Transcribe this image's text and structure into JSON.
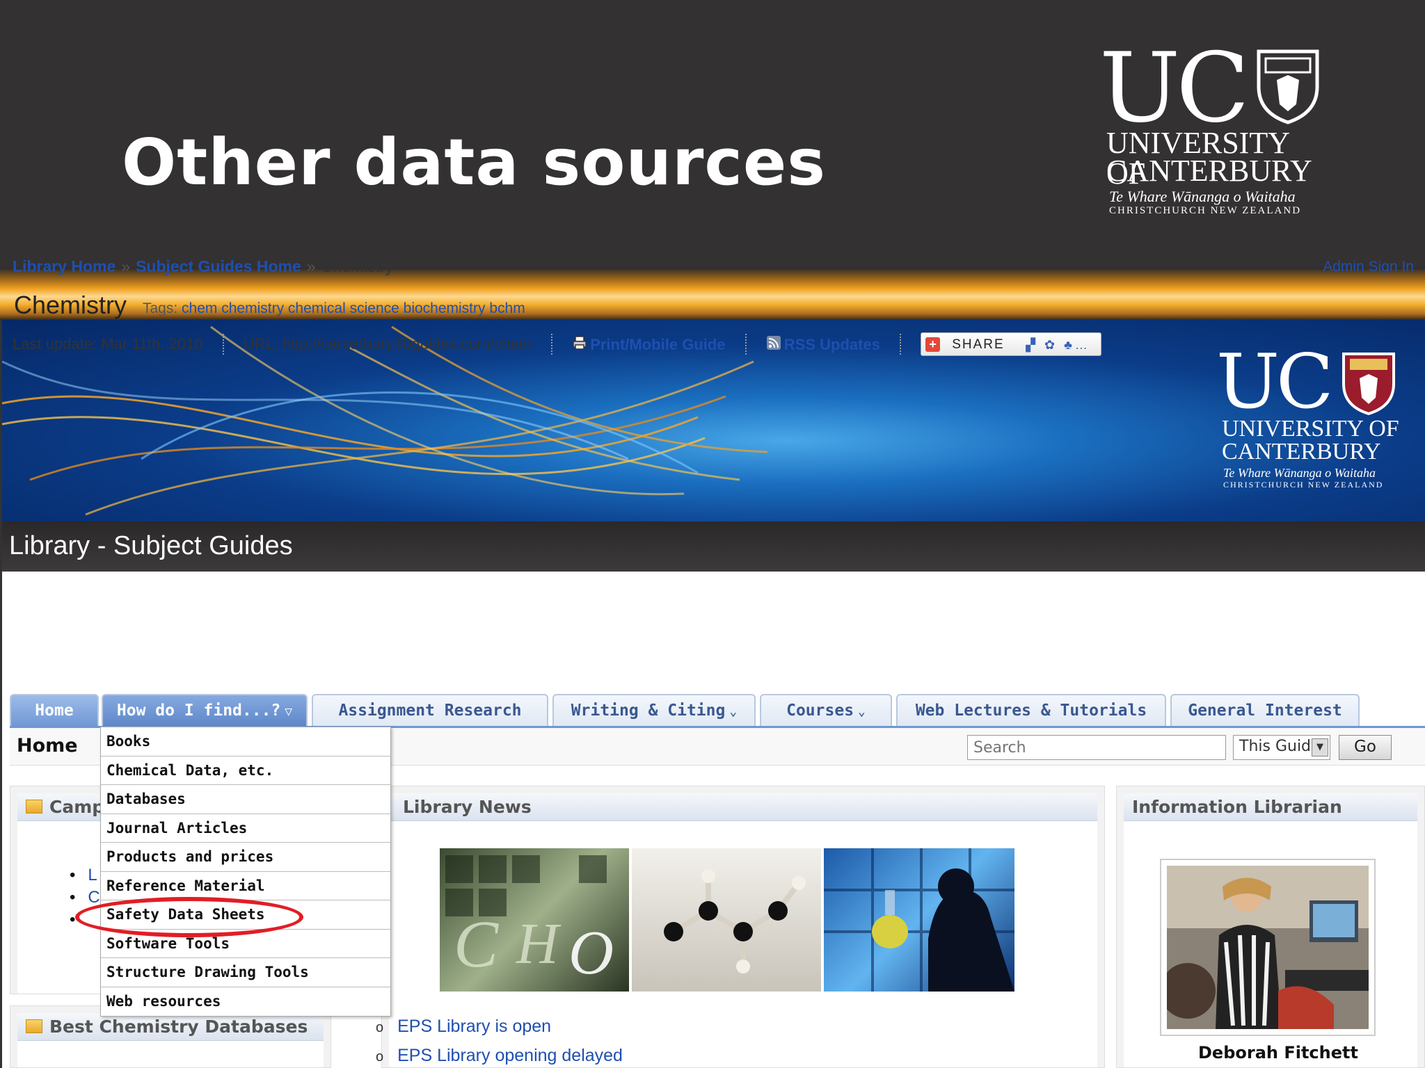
{
  "slide": {
    "title": "Other data sources",
    "logo": {
      "mark": "UC",
      "line1": "UNIVERSITY OF",
      "line2": "CANTERBURY",
      "line3": "Te Whare Wānanga o Waitaha",
      "line4": "CHRISTCHURCH NEW ZEALAND"
    }
  },
  "colors": {
    "slide_bg": "#333132",
    "link": "#1f4fb0",
    "tab_active": "#5d86c8",
    "highlight": "#e21d25"
  },
  "site": {
    "banner_logo": {
      "mark": "UC",
      "line1": "UNIVERSITY OF",
      "line2": "CANTERBURY",
      "line3": "Te Whare Wānanga o Waitaha",
      "line4": "CHRISTCHURCH NEW ZEALAND"
    },
    "section_title": "Library - Subject Guides",
    "breadcrumb": {
      "items": [
        "Library Home",
        "Subject Guides Home"
      ],
      "current": "Chemistry",
      "separator": "»"
    },
    "admin_link": "Admin Sign In",
    "guide": {
      "title": "Chemistry",
      "tags_label": "Tags:",
      "tags": "chem chemistry chemical science biochemistry bchm",
      "last_update": "Last update: Mar 11th, 2010",
      "url": "URL: http://canterbury.libguides.com/chem",
      "print_label": "Print/Mobile Guide",
      "rss_label": "RSS Updates",
      "share_label": "SHARE",
      "share_icons": "▞ ✿ ♣…"
    },
    "tabs": [
      {
        "label": "Home"
      },
      {
        "label": "How do I find...?",
        "chevron": "▽"
      },
      {
        "label": "Assignment Research"
      },
      {
        "label": "Writing & Citing",
        "chevron": "⌄"
      },
      {
        "label": "Courses",
        "chevron": "⌄"
      },
      {
        "label": "Web Lectures & Tutorials"
      },
      {
        "label": "General Interest"
      }
    ],
    "subbar": {
      "page_label": "Home",
      "search_placeholder": "Search",
      "scope": "This Guide",
      "go_label": "Go"
    },
    "dropdown_items": [
      "Books",
      "Chemical Data, etc.",
      "Databases",
      "Journal Articles",
      "Products and prices",
      "Reference Material",
      "Safety Data Sheets",
      "Software Tools",
      "Structure Drawing Tools",
      "Web resources"
    ],
    "highlighted_item": "Safety Data Sheets",
    "panels": {
      "left_top_title": "Camp",
      "left_bottom_title": "Best Chemistry Databases",
      "left_bullets": [
        "L",
        "C",
        ""
      ],
      "news_title": "Library News",
      "news_items": [
        "EPS Library is open",
        "EPS Library opening delayed"
      ],
      "librarian_title": "Information Librarian",
      "librarian_name": "Deborah Fitchett"
    }
  }
}
